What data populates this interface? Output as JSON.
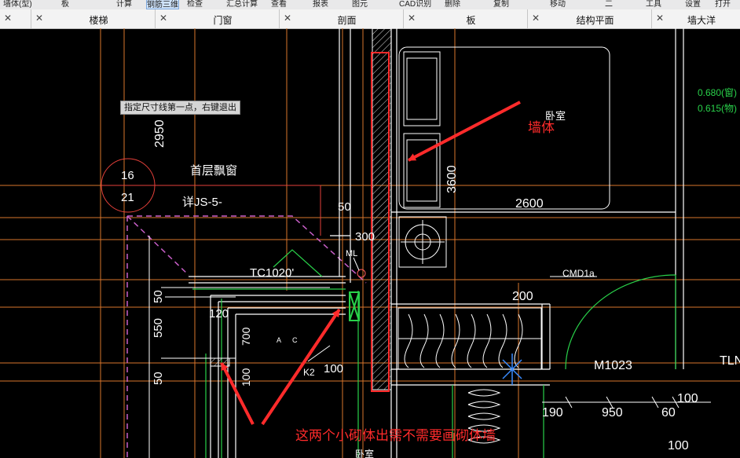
{
  "toolbar": {
    "items": [
      "墙体(型)",
      "板",
      "计算",
      "动态观察",
      "钢筋三维",
      "检查",
      "汇总计算",
      "查看",
      "报表",
      "图元",
      "CAD识别",
      "删除",
      "复制",
      "移动",
      "二",
      "工具",
      "设置",
      "打开"
    ],
    "active_index": 4
  },
  "tabs": [
    {
      "label": "楼梯"
    },
    {
      "label": "门窗"
    },
    {
      "label": "剖面"
    },
    {
      "label": "板"
    },
    {
      "label": "结构平面"
    },
    {
      "label": "墙大洋"
    }
  ],
  "tab_close_glyph": "✕",
  "tooltip": "指定尺寸线第一点，右键退出",
  "annotations": {
    "wall_label": "墙体",
    "question": "这两个小砌体出需不需要画砌体墙"
  },
  "drawing": {
    "labels": {
      "dim_2950": "2950",
      "circle_top": "16",
      "circle_bottom": "21",
      "first_floor_bay": "首层飘窗",
      "detail_ref": "详JS-5-",
      "tc1020": "TC1020'",
      "dim_50_top": "50",
      "dim_300": "300",
      "ml": "ML",
      "bedroom_top": "卧室",
      "dim_3600": "3600",
      "dim_2600": "2600",
      "level_680": "0.680(窗)",
      "level_615": "0.615(物)",
      "cmd": "CMD1a",
      "dim_200": "200",
      "m1023": "M1023",
      "tln": "TLN",
      "dim_50_left": "50",
      "dim_550": "550",
      "dim_50_low": "50",
      "dim_120": "120",
      "dim_700": "700",
      "dim_100_left": "100",
      "hatch_a": "A",
      "hatch_c": "C",
      "k2": "K2",
      "dim_100_mid": "100",
      "dim_190": "190",
      "dim_950": "950",
      "dim_60": "60",
      "dim_100_r1": "100",
      "dim_100_r2": "100",
      "bedroom_bottom": "卧室"
    }
  },
  "colors": {
    "background": "#000000",
    "cad_grid": "#e07a2a",
    "cad_wall": "#ffffff",
    "cad_magenta": "#c85fc8",
    "cad_green": "#29d14a",
    "annotation_red": "#ff2b2b"
  }
}
